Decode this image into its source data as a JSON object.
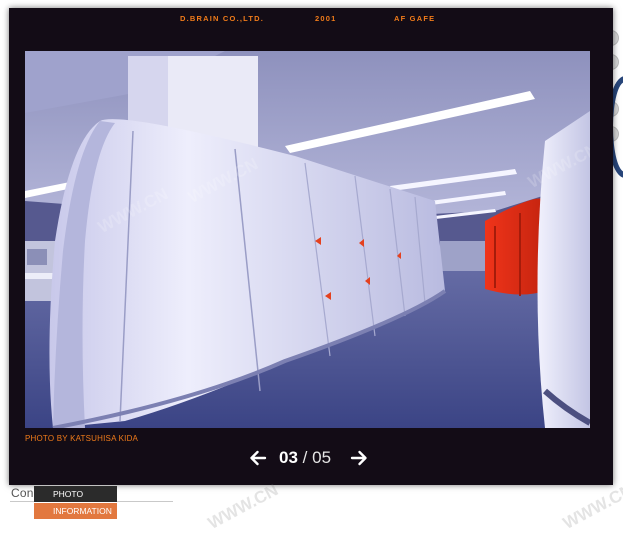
{
  "header": {
    "company": "D.BRAIN CO.,LTD.",
    "year": "2001",
    "project": "AF GAFE"
  },
  "photo": {
    "credit": "PHOTO BY KATSUHISA KIDA"
  },
  "pager": {
    "current": "03",
    "separator": "/",
    "total": "05",
    "prev_icon": "arrow-left-icon",
    "next_icon": "arrow-right-icon"
  },
  "tabs": [
    {
      "label": "PHOTO"
    },
    {
      "label": "INFORMATION"
    }
  ],
  "underlay": {
    "text": "Con"
  },
  "watermark": {
    "text": "WWW.CN"
  },
  "colors": {
    "accent": "#f07b1a",
    "panel": "#130c16",
    "info_tab": "#e2783f"
  }
}
